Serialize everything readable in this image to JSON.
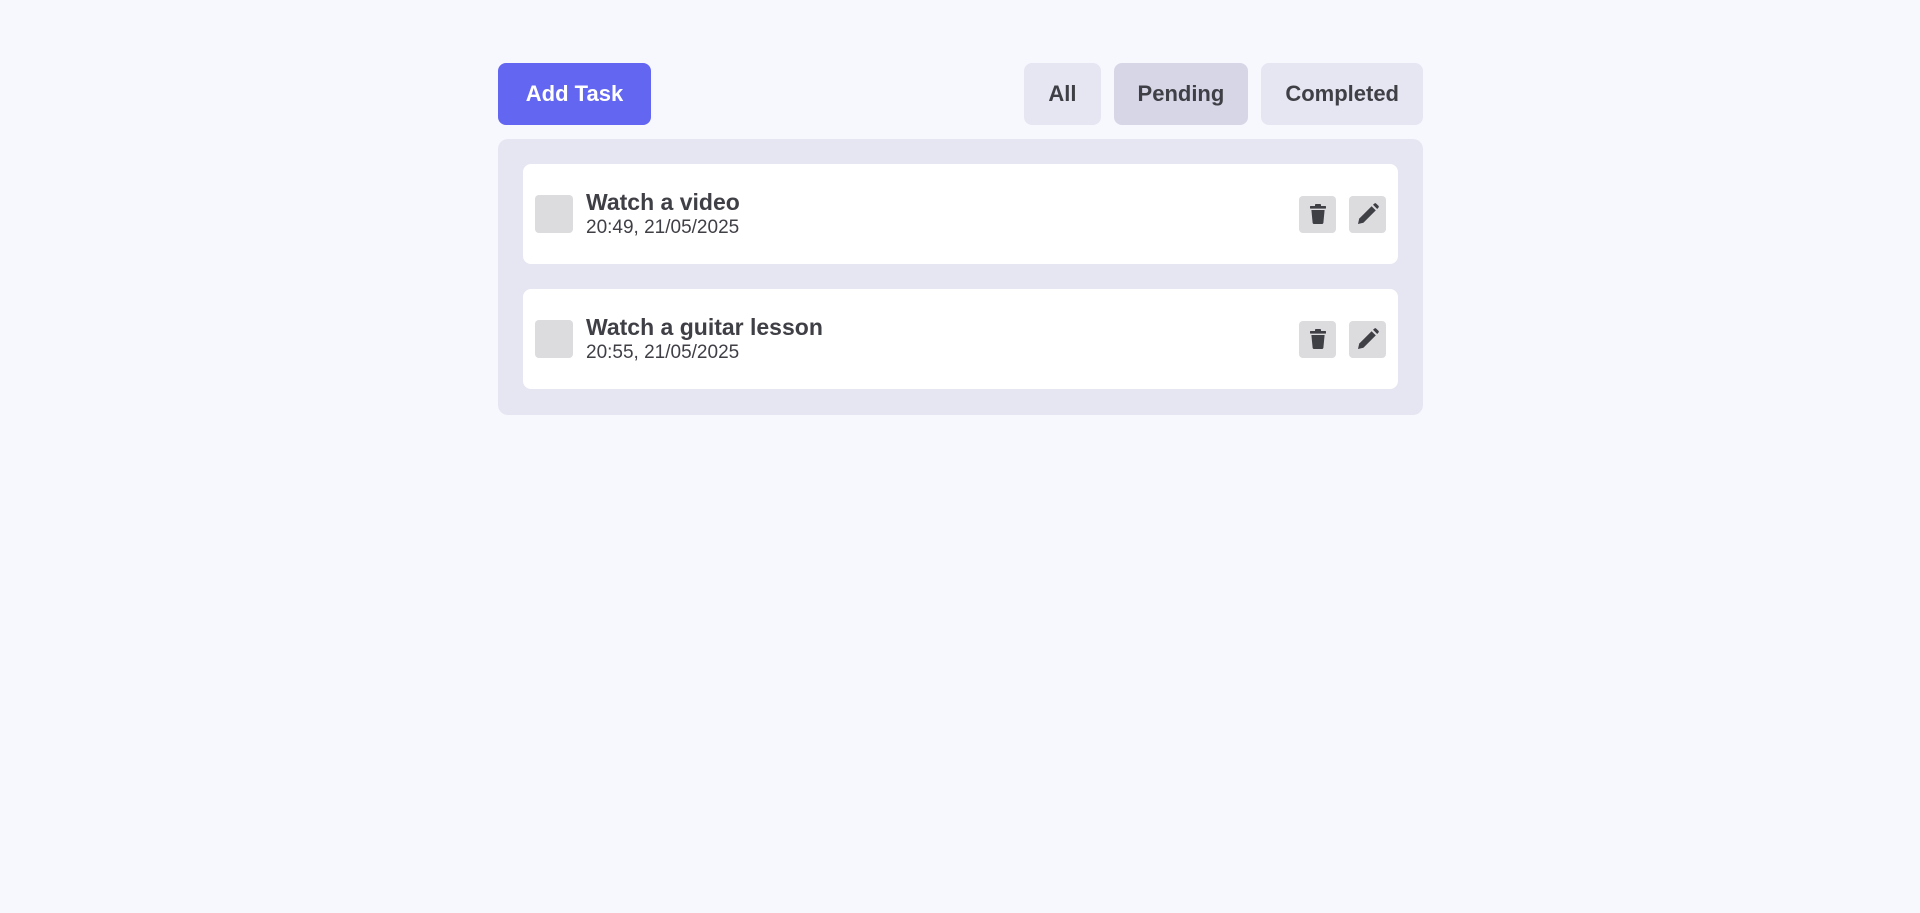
{
  "toolbar": {
    "add_label": "Add Task",
    "filters": [
      {
        "label": "All",
        "active": false
      },
      {
        "label": "Pending",
        "active": true
      },
      {
        "label": "Completed",
        "active": false
      }
    ]
  },
  "tasks": [
    {
      "title": "Watch a video",
      "time": "20:49, 21/05/2025",
      "completed": false,
      "delete_icon": "trash-icon",
      "edit_icon": "pencil-icon"
    },
    {
      "title": "Watch a guitar lesson",
      "time": "20:55, 21/05/2025",
      "completed": false,
      "delete_icon": "trash-icon",
      "edit_icon": "pencil-icon"
    }
  ],
  "colors": {
    "accent": "#6366f1",
    "page_background": "#f7f8fd",
    "panel_background": "#e6e6f2",
    "active_filter": "#d6d6e7",
    "text": "#3f3f46"
  }
}
